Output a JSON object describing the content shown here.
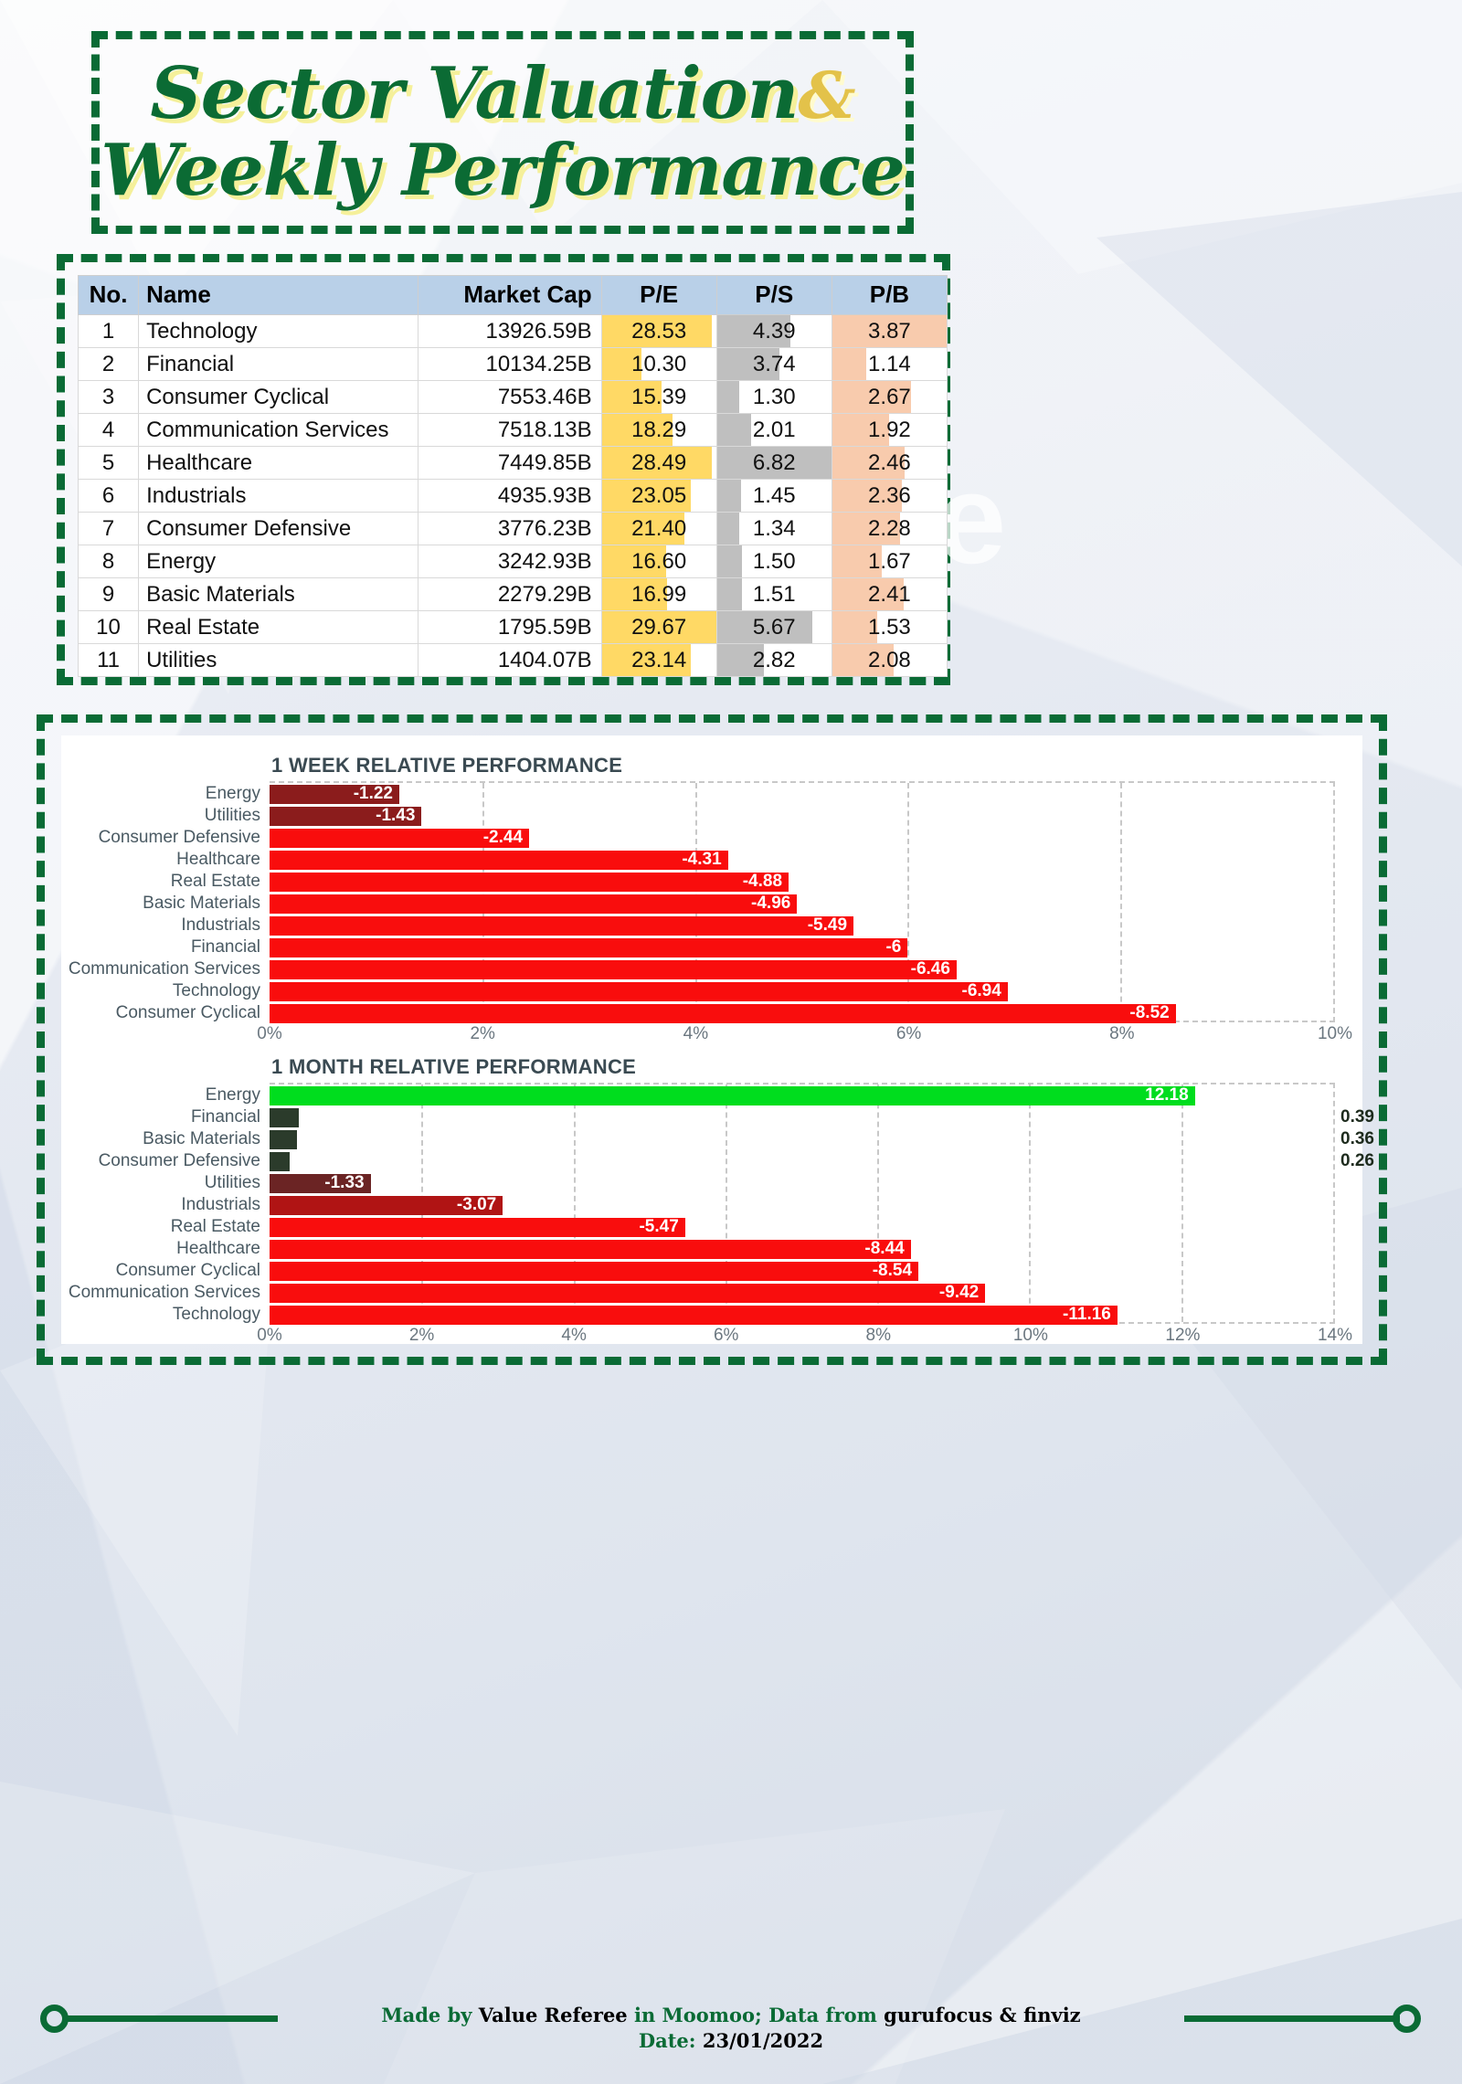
{
  "title": {
    "line1_a": "Sector Valuation",
    "line1_amp": "&",
    "line2": "Weekly Performance"
  },
  "watermark": "Value Referee",
  "colors": {
    "brand_green": "#0a6b35",
    "title_shadow": "#f5f09a",
    "amp_gold": "#e3c24a",
    "header_blue": "#b9d0e8",
    "pe_bar": "#ffd965",
    "ps_bar": "#bfbfbf",
    "pb_bar": "#f8cbad",
    "bright_red": "#f90d0d",
    "dark_red": "#8b1c1c",
    "mid_red": "#b01414",
    "bright_green": "#00dd1e",
    "dark_green": "#2b3b2b"
  },
  "table": {
    "columns": [
      "No.",
      "Name",
      "Market Cap",
      "P/E",
      "P/S",
      "P/B"
    ],
    "max": {
      "pe": 29.67,
      "ps": 6.82,
      "pb": 3.87
    },
    "rows": [
      {
        "no": "1",
        "name": "Technology",
        "cap": "13926.59B",
        "pe": "28.53",
        "ps": "4.39",
        "pb": "3.87"
      },
      {
        "no": "2",
        "name": "Financial",
        "cap": "10134.25B",
        "pe": "10.30",
        "ps": "3.74",
        "pb": "1.14"
      },
      {
        "no": "3",
        "name": "Consumer Cyclical",
        "cap": "7553.46B",
        "pe": "15.39",
        "ps": "1.30",
        "pb": "2.67"
      },
      {
        "no": "4",
        "name": "Communication Services",
        "cap": "7518.13B",
        "pe": "18.29",
        "ps": "2.01",
        "pb": "1.92"
      },
      {
        "no": "5",
        "name": "Healthcare",
        "cap": "7449.85B",
        "pe": "28.49",
        "ps": "6.82",
        "pb": "2.46"
      },
      {
        "no": "6",
        "name": "Industrials",
        "cap": "4935.93B",
        "pe": "23.05",
        "ps": "1.45",
        "pb": "2.36"
      },
      {
        "no": "7",
        "name": "Consumer Defensive",
        "cap": "3776.23B",
        "pe": "21.40",
        "ps": "1.34",
        "pb": "2.28"
      },
      {
        "no": "8",
        "name": "Energy",
        "cap": "3242.93B",
        "pe": "16.60",
        "ps": "1.50",
        "pb": "1.67"
      },
      {
        "no": "9",
        "name": "Basic Materials",
        "cap": "2279.29B",
        "pe": "16.99",
        "ps": "1.51",
        "pb": "2.41"
      },
      {
        "no": "10",
        "name": "Real Estate",
        "cap": "1795.59B",
        "pe": "29.67",
        "ps": "5.67",
        "pb": "1.53"
      },
      {
        "no": "11",
        "name": "Utilities",
        "cap": "1404.07B",
        "pe": "23.14",
        "ps": "2.82",
        "pb": "2.08"
      }
    ]
  },
  "chart_data": [
    {
      "type": "bar",
      "orientation": "horizontal",
      "title": "1 WEEK RELATIVE PERFORMANCE",
      "xlabel": "",
      "ylabel": "",
      "xlim": [
        0,
        10
      ],
      "xticks": [
        "0%",
        "2%",
        "4%",
        "6%",
        "8%",
        "10%"
      ],
      "xtick_values": [
        0,
        2,
        4,
        6,
        8,
        10
      ],
      "grid": true,
      "legend": "none",
      "categories": [
        "Energy",
        "Utilities",
        "Consumer Defensive",
        "Healthcare",
        "Real Estate",
        "Basic Materials",
        "Industrials",
        "Financial",
        "Communication Services",
        "Technology",
        "Consumer Cyclical"
      ],
      "values": [
        -1.22,
        -1.43,
        -2.44,
        -4.31,
        -4.88,
        -4.96,
        -5.49,
        -6,
        -6.46,
        -6.94,
        -8.52
      ],
      "labels": [
        "-1.22",
        "-1.43",
        "-2.44",
        "-4.31",
        "-4.88",
        "-4.96",
        "-5.49",
        "-6",
        "-6.46",
        "-6.94",
        "-8.52"
      ],
      "bar_colors": [
        "#8b1c1c",
        "#8b1c1c",
        "#f90d0d",
        "#f90d0d",
        "#f90d0d",
        "#f90d0d",
        "#f90d0d",
        "#f90d0d",
        "#f90d0d",
        "#f90d0d",
        "#f90d0d"
      ],
      "label_colors": [
        "#ffffff",
        "#ffffff",
        "#ffffff",
        "#ffffff",
        "#ffffff",
        "#ffffff",
        "#ffffff",
        "#ffffff",
        "#ffffff",
        "#ffffff",
        "#ffffff"
      ],
      "label_inside": [
        true,
        true,
        true,
        true,
        true,
        true,
        true,
        true,
        true,
        true,
        true
      ]
    },
    {
      "type": "bar",
      "orientation": "horizontal",
      "title": "1 MONTH RELATIVE PERFORMANCE",
      "xlabel": "",
      "ylabel": "",
      "xlim": [
        0,
        14
      ],
      "xticks": [
        "0%",
        "2%",
        "4%",
        "6%",
        "8%",
        "10%",
        "12%",
        "14%"
      ],
      "xtick_values": [
        0,
        2,
        4,
        6,
        8,
        10,
        12,
        14
      ],
      "grid": true,
      "legend": "none",
      "categories": [
        "Energy",
        "Financial",
        "Basic Materials",
        "Consumer Defensive",
        "Utilities",
        "Industrials",
        "Real Estate",
        "Healthcare",
        "Consumer Cyclical",
        "Communication Services",
        "Technology"
      ],
      "values": [
        12.18,
        0.39,
        0.36,
        0.26,
        -1.33,
        -3.07,
        -5.47,
        -8.44,
        -8.54,
        -9.42,
        -11.16
      ],
      "labels": [
        "12.18",
        "0.39",
        "0.36",
        "0.26",
        "-1.33",
        "-3.07",
        "-5.47",
        "-8.44",
        "-8.54",
        "-9.42",
        "-11.16"
      ],
      "bar_colors": [
        "#00dd1e",
        "#2b3b2b",
        "#2b3b2b",
        "#2b3b2b",
        "#6b2424",
        "#b01414",
        "#f90d0d",
        "#f90d0d",
        "#f90d0d",
        "#f90d0d",
        "#f90d0d"
      ],
      "label_colors": [
        "#ffffff",
        "#1d2b1d",
        "#1d2b1d",
        "#1d2b1d",
        "#ffffff",
        "#ffffff",
        "#ffffff",
        "#ffffff",
        "#ffffff",
        "#ffffff",
        "#ffffff"
      ],
      "label_inside": [
        true,
        false,
        false,
        false,
        true,
        true,
        true,
        true,
        true,
        true,
        true
      ]
    }
  ],
  "footer": {
    "made_by": "Made by ",
    "author": "Value Referee",
    "middle": " in Moomoo; Data from ",
    "sources": "gurufocus & finviz",
    "date_label": "Date: ",
    "date_value": "23/01/2022"
  }
}
